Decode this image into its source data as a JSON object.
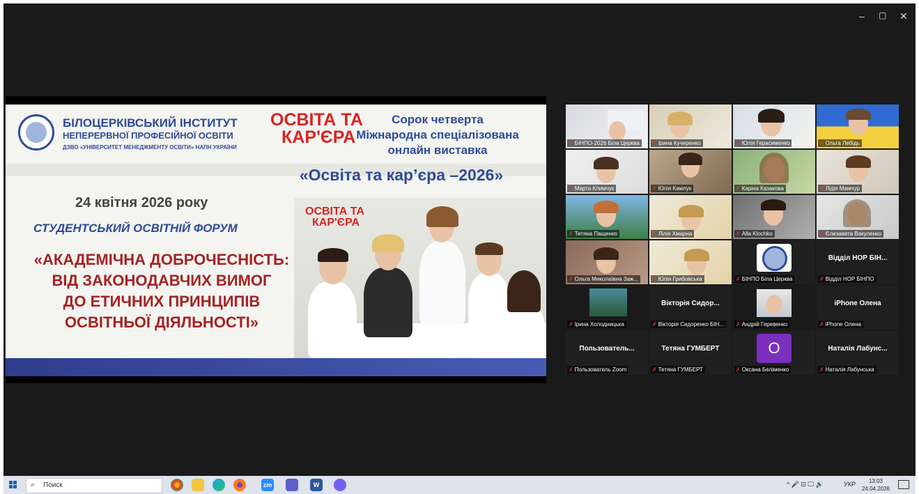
{
  "window_controls": {
    "minimize": "–",
    "restore": "▢",
    "close": "✕"
  },
  "slide": {
    "institute_line1": "БІЛОЦЕРКІВСЬКИЙ ІНСТИТУТ",
    "institute_line2": "НЕПЕРЕРВНОЇ ПРОФЕСІЙНОЇ ОСВІТИ",
    "institute_line3": "ДЗВО «УНІВЕРСИТЕТ МЕНЕДЖМЕНТУ ОСВІТИ» НАПН УКРАЇНИ",
    "brand_top": "ОСВІТА ТА",
    "brand_bottom": "КАР'ЄРА",
    "exhibition_line1": "Сорок четверта",
    "exhibition_line2": "Міжнародна спеціалізована",
    "exhibition_line3": "онлайн виставка",
    "exhibition_title": "«Освіта та кар’єра –2026»",
    "date": "24 квітня 2026 року",
    "forum": "СТУДЕНТСЬКИЙ ОСВІТНІЙ ФОРУМ",
    "title_line1": "«АКАДЕМІЧНА ДОБРОЧЕСНІСТЬ:",
    "title_line2": "ВІД ЗАКОНОДАВЧИХ ВИМОГ",
    "title_line3": "ДО ЕТИЧНИХ ПРИНЦИПІВ",
    "title_line4": "ОСВІТНЬОЇ ДІЯЛЬНОСТІ»"
  },
  "participants": [
    {
      "name": "БІНПО-2026 Біла Церква"
    },
    {
      "name": "Ірина Кучеренко"
    },
    {
      "name": "Юлія Герасименко"
    },
    {
      "name": "Ольга Лебідь"
    },
    {
      "name": "Марта Климчук"
    },
    {
      "name": "Юлія Камлук"
    },
    {
      "name": "Каріна Казакова"
    },
    {
      "name": "Лідія Мамчур"
    },
    {
      "name": "Тетяна Пащенко"
    },
    {
      "name": "Лілія Хмарна"
    },
    {
      "name": "Alla Klochko"
    },
    {
      "name": "Єлизавета Вакуленко"
    },
    {
      "name": "Ольга Миколаївна Заж..."
    },
    {
      "name": "Юлія Грибовська"
    },
    {
      "name": "БІНПО Біла Церква"
    },
    {
      "name": "Відділ НОР БІНПО",
      "display": "Відділ НОР БІН..."
    },
    {
      "name": "Ірина Холодницька"
    },
    {
      "name": "Вікторія Сидоренко БІН...",
      "display": "Вікторія Сидор..."
    },
    {
      "name": "Андрій Геревенко"
    },
    {
      "name": "iPhone Олена",
      "display": "iPhone Олена"
    },
    {
      "name": "Пользователь Zoom",
      "display": "Пользователь..."
    },
    {
      "name": "Тетяна ГУМБЕРТ",
      "display": "Тетяна ГУМБЕРТ"
    },
    {
      "name": "Оксана Беліменко",
      "display": "O"
    },
    {
      "name": "Наталія Лабунська",
      "display": "Наталія Лабунс..."
    }
  ],
  "taskbar": {
    "search_placeholder": "Поиск",
    "apps": [
      "chrome-icon",
      "file-explorer-icon",
      "edge-icon",
      "firefox-icon",
      "zoom-icon",
      "teams-icon",
      "word-icon",
      "viber-icon"
    ],
    "zoom_label": "zm",
    "word_label": "W",
    "tray_symbols": "^ 🎤 ⊡ 🖵 🔊",
    "lang": "УКР",
    "time": "13:03",
    "date": "24.04.2026"
  },
  "colors": {
    "accent_blue": "#2e4b99",
    "accent_red": "#a42323",
    "active_speaker": "#35c35a",
    "avatar_purple": "#7b2fbe"
  }
}
